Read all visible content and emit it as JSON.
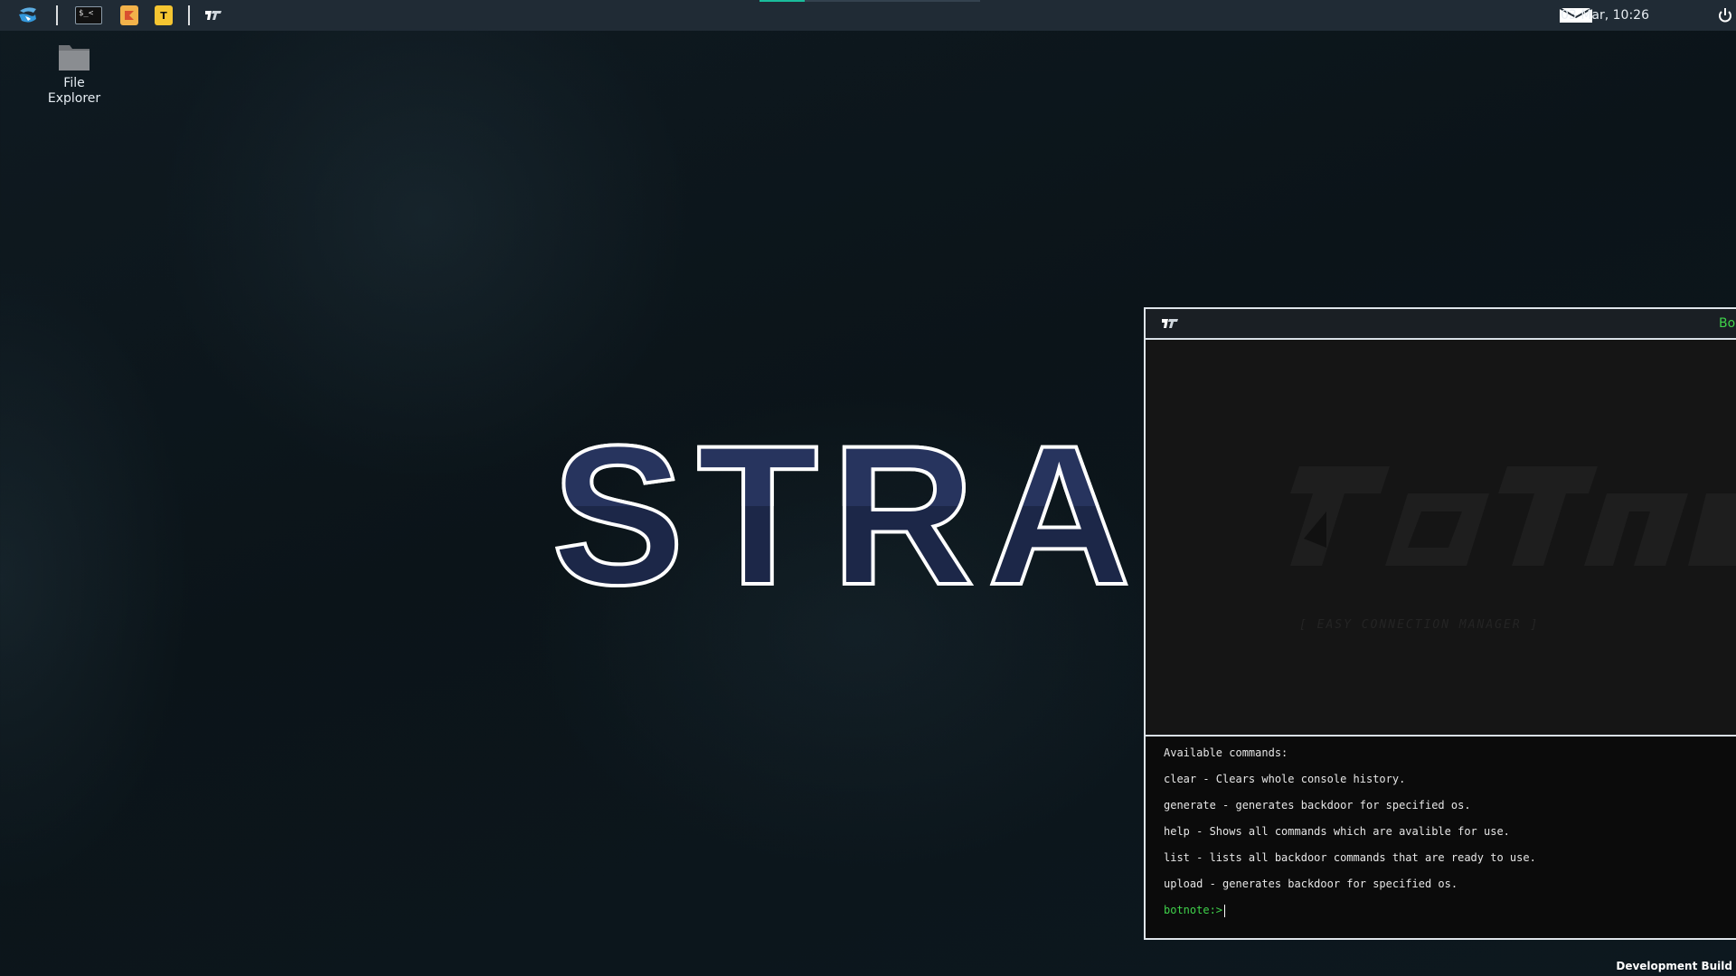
{
  "taskbar": {
    "apps": [
      {
        "name": "start-logo-icon"
      },
      {
        "name": "terminal-icon",
        "glyph": "$_<"
      },
      {
        "name": "app-icon-orange"
      },
      {
        "name": "app-icon-yellow",
        "glyph": "T"
      },
      {
        "name": "botnet-app-icon"
      }
    ],
    "date_time": "03 Mar, 10:26",
    "accent_color": "#1abc9c"
  },
  "desktop": {
    "items": [
      {
        "label_line1": "File",
        "label_line2": "Explorer"
      }
    ],
    "wallpaper_text": "STRAP"
  },
  "botnet_window": {
    "title": "Bo",
    "banner_subtitle": "[ EASY CONNECTION MANAGER ]",
    "console_lines": [
      "Available commands:",
      "clear - Clears whole console history.",
      "generate - generates backdoor for specified os.",
      "help - Shows all commands which are avalible for use.",
      "list - lists all backdoor commands that are ready to use.",
      "upload - generates backdoor for specified os."
    ],
    "prompt": "botnote:>",
    "input_value": "",
    "prompt_color": "#3fd24a"
  },
  "footer": {
    "build_label": "Development Build"
  }
}
